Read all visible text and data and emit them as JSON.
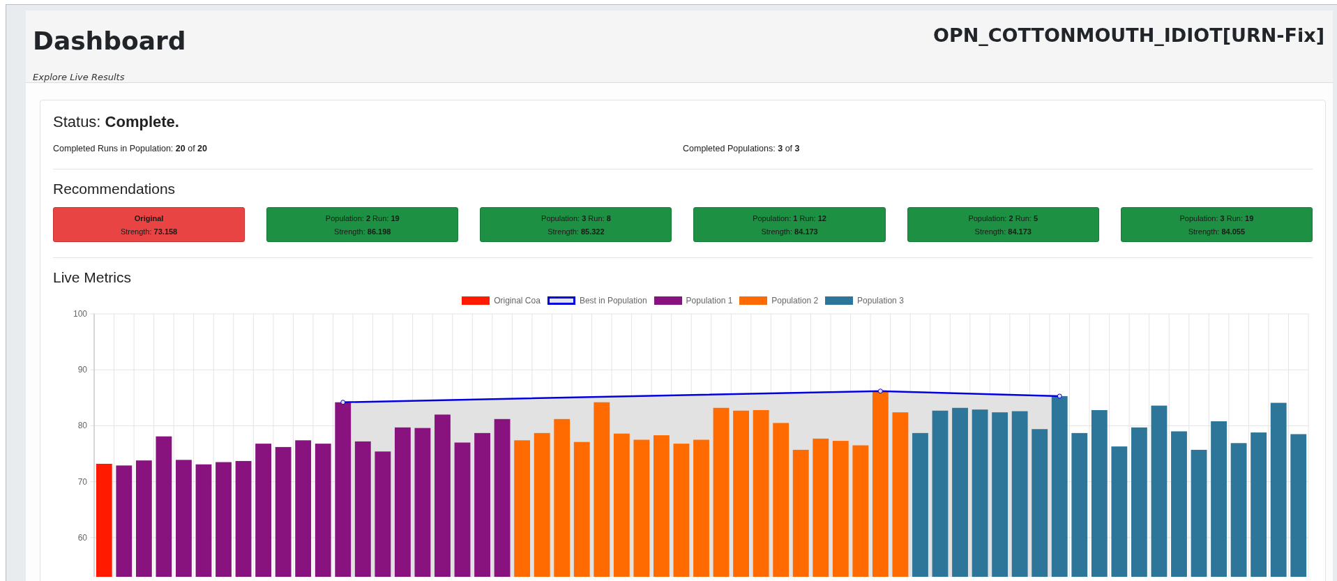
{
  "header": {
    "title": "Dashboard",
    "subtitle": "Explore Live Results",
    "run_name": "OPN_COTTONMOUTH_IDIOT[URN-Fix]"
  },
  "status": {
    "heading": "Status: **Complete.**",
    "runs": "Completed Runs in Population: **20** of **20**",
    "populations": "Completed Populations: **3** of **3**"
  },
  "recommendations": {
    "title": "Recommendations",
    "items": [
      {
        "kind": "original",
        "title": "Original",
        "strength": "Strength: **73.158**"
      },
      {
        "kind": "candidate",
        "title": "Population: **2** Run: **19**",
        "strength": "Strength: **86.198**"
      },
      {
        "kind": "candidate",
        "title": "Population: **3** Run: **8**",
        "strength": "Strength: **85.322**"
      },
      {
        "kind": "candidate",
        "title": "Population: **1** Run: **12**",
        "strength": "Strength: **84.173**"
      },
      {
        "kind": "candidate",
        "title": "Population: **2** Run: **5**",
        "strength": "Strength: **84.173**"
      },
      {
        "kind": "candidate",
        "title": "Population: **3** Run: **19**",
        "strength": "Strength: **84.055**"
      }
    ]
  },
  "live_metrics": {
    "title": "Live Metrics",
    "chart_data": {
      "type": "bar",
      "grid": true,
      "ylim": [
        53,
        100
      ],
      "yticks": [
        60,
        70,
        80,
        90,
        100
      ],
      "series": [
        {
          "name": "Original Coa",
          "color": "#ff1a00",
          "values": [
            73.2,
            null,
            null,
            null,
            null,
            null,
            null,
            null,
            null,
            null,
            null,
            null,
            null,
            null,
            null,
            null,
            null,
            null,
            null,
            null,
            null,
            null,
            null,
            null,
            null,
            null,
            null,
            null,
            null,
            null,
            null,
            null,
            null,
            null,
            null,
            null,
            null,
            null,
            null,
            null,
            null,
            null,
            null,
            null,
            null,
            null,
            null,
            null,
            null,
            null,
            null,
            null,
            null,
            null,
            null,
            null,
            null,
            null,
            null,
            null,
            null
          ]
        },
        {
          "name": "Best in Population",
          "type": "line",
          "marker": true,
          "color": "#0000dd",
          "values": [
            null,
            null,
            null,
            null,
            null,
            null,
            null,
            null,
            null,
            null,
            null,
            null,
            84.2,
            null,
            null,
            null,
            null,
            null,
            null,
            null,
            null,
            null,
            null,
            null,
            null,
            null,
            null,
            null,
            null,
            null,
            null,
            null,
            null,
            null,
            null,
            null,
            null,
            null,
            null,
            86.2,
            null,
            null,
            null,
            null,
            null,
            null,
            null,
            null,
            85.3,
            null,
            null,
            null,
            null,
            null,
            null,
            null,
            null,
            null,
            null,
            null,
            null
          ]
        },
        {
          "name": "Population 1",
          "color": "#88137e",
          "values": [
            null,
            72.9,
            73.8,
            78.1,
            73.9,
            73.1,
            73.5,
            73.7,
            76.8,
            76.2,
            77.4,
            76.8,
            84.2,
            77.2,
            75.4,
            79.7,
            79.6,
            82.0,
            77.0,
            78.7,
            81.2,
            null,
            null,
            null,
            null,
            null,
            null,
            null,
            null,
            null,
            null,
            null,
            null,
            null,
            null,
            null,
            null,
            null,
            null,
            null,
            null,
            null,
            null,
            null,
            null,
            null,
            null,
            null,
            null,
            null,
            null,
            null,
            null,
            null,
            null,
            null,
            null,
            null,
            null,
            null,
            null
          ]
        },
        {
          "name": "Population 2",
          "color": "#ff6b00",
          "values": [
            null,
            null,
            null,
            null,
            null,
            null,
            null,
            null,
            null,
            null,
            null,
            null,
            null,
            null,
            null,
            null,
            null,
            null,
            null,
            null,
            null,
            77.4,
            78.7,
            81.2,
            77.1,
            84.2,
            78.6,
            77.5,
            78.3,
            76.8,
            77.5,
            83.2,
            82.7,
            82.8,
            80.5,
            75.7,
            77.7,
            77.3,
            76.5,
            86.2,
            82.4,
            null,
            null,
            null,
            null,
            null,
            null,
            null,
            null,
            null,
            null,
            null,
            null,
            null,
            null,
            null,
            null,
            null,
            null,
            null,
            null
          ]
        },
        {
          "name": "Population 3",
          "color": "#2e7699",
          "values": [
            null,
            null,
            null,
            null,
            null,
            null,
            null,
            null,
            null,
            null,
            null,
            null,
            null,
            null,
            null,
            null,
            null,
            null,
            null,
            null,
            null,
            null,
            null,
            null,
            null,
            null,
            null,
            null,
            null,
            null,
            null,
            null,
            null,
            null,
            null,
            null,
            null,
            null,
            null,
            null,
            null,
            78.7,
            82.7,
            83.2,
            82.9,
            82.4,
            82.6,
            79.4,
            85.3,
            78.7,
            82.8,
            76.3,
            79.7,
            83.6,
            79.0,
            75.7,
            80.8,
            76.9,
            78.8,
            84.1,
            78.5
          ]
        }
      ]
    }
  }
}
